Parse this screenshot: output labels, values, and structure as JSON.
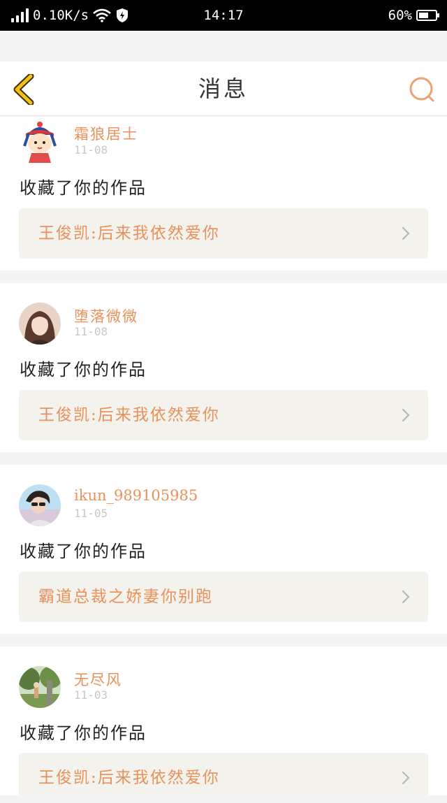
{
  "status_bar": {
    "speed": "0.10K/s",
    "time": "14:17",
    "battery": "60%",
    "battery_level": 0.6
  },
  "header": {
    "title": "消息"
  },
  "colors": {
    "accent": "#e8915a",
    "back_icon": "#f2c21b"
  },
  "messages": [
    {
      "username": "霜狼居士",
      "date": "11-08",
      "action": "收藏了你的作品",
      "work_title": "王俊凯:后来我依然爱你",
      "avatar_icon": "cartoon-avatar"
    },
    {
      "username": "堕落微微",
      "date": "11-08",
      "action": "收藏了你的作品",
      "work_title": "王俊凯:后来我依然爱你",
      "avatar_icon": "photo-avatar"
    },
    {
      "username": "ikun_989105985",
      "date": "11-05",
      "action": "收藏了你的作品",
      "work_title": "霸道总裁之娇妻你别跑",
      "avatar_icon": "photo-avatar"
    },
    {
      "username": "无尽风",
      "date": "11-03",
      "action": "收藏了你的作品",
      "work_title": "王俊凯:后来我依然爱你",
      "avatar_icon": "photo-avatar"
    }
  ]
}
